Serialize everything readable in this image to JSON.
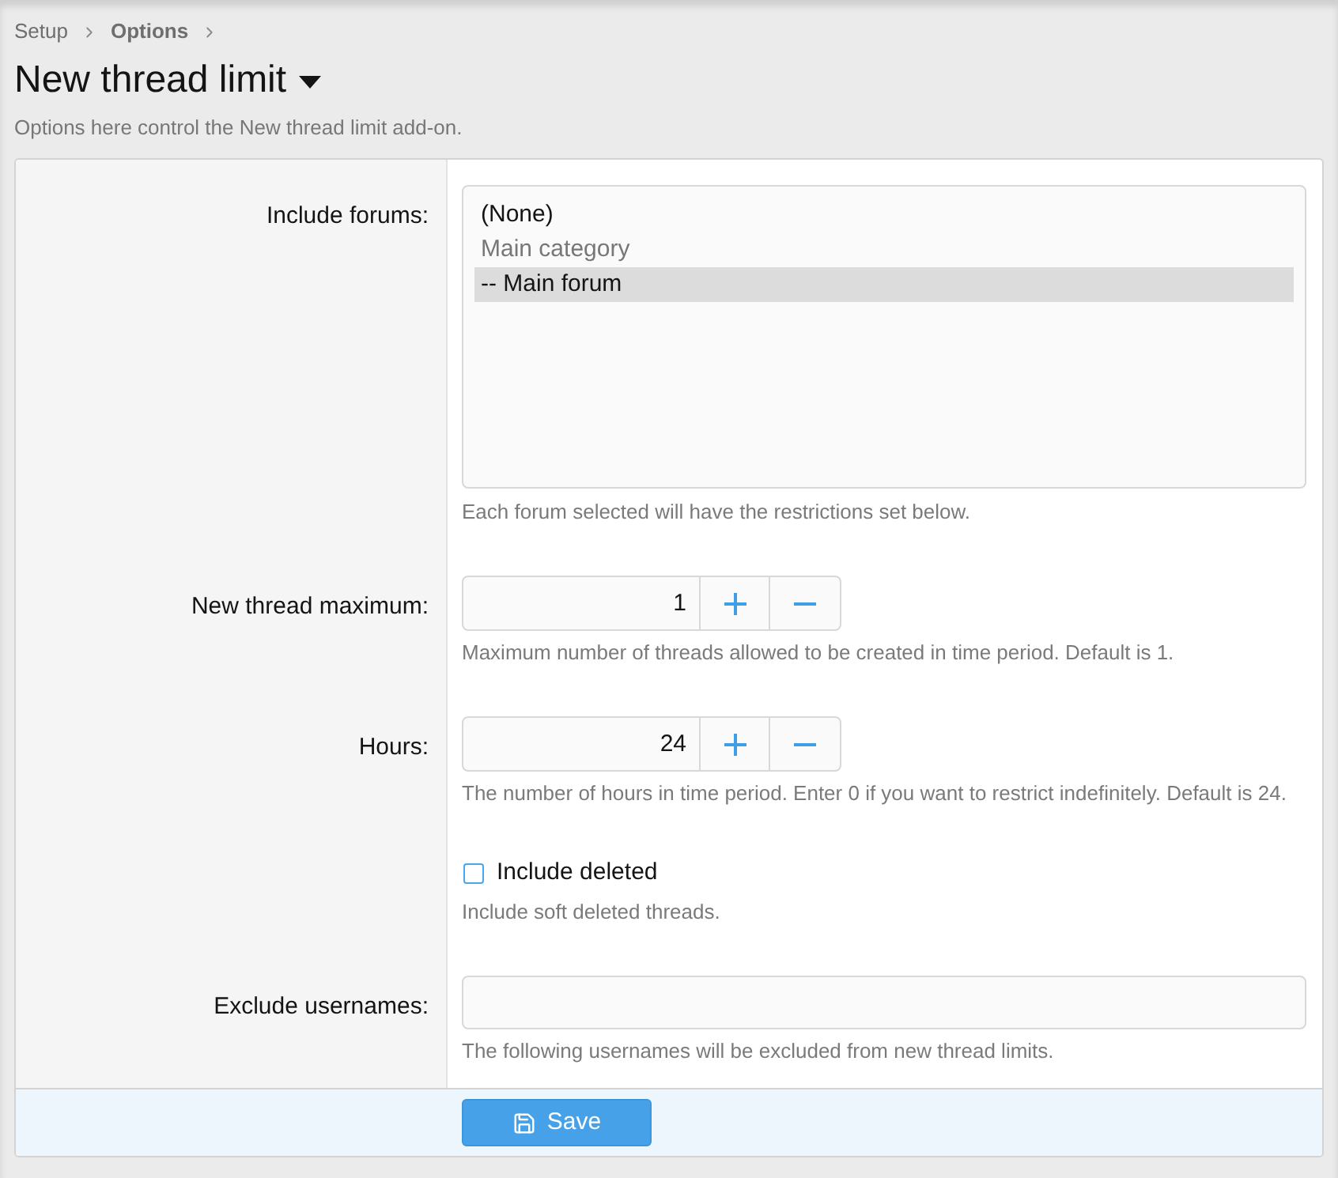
{
  "breadcrumb": [
    {
      "label": "Setup",
      "current": false
    },
    {
      "label": "Options",
      "current": true
    }
  ],
  "page": {
    "title": "New thread limit",
    "description": "Options here control the New thread limit add-on."
  },
  "form": {
    "rows": [
      {
        "kind": "listbox",
        "label": "Include forums:",
        "options": [
          {
            "label": "(None)",
            "disabled": false,
            "selected": false
          },
          {
            "label": "Main category",
            "disabled": true,
            "selected": false
          },
          {
            "label": "-- Main forum",
            "disabled": false,
            "selected": true
          }
        ],
        "hint": "Each forum selected will have the restrictions set below."
      },
      {
        "kind": "number",
        "label": "New thread maximum:",
        "value": "1",
        "hint": "Maximum number of threads allowed to be created in time period. Default is 1."
      },
      {
        "kind": "number",
        "label": "Hours:",
        "value": "24",
        "hint": "The number of hours in time period. Enter 0 if you want to restrict indefinitely. Default is 24."
      },
      {
        "kind": "checkbox",
        "text": "Include deleted",
        "checked": false,
        "hint": "Include soft deleted threads."
      },
      {
        "kind": "text",
        "label": "Exclude usernames:",
        "hint": "The following usernames will be excluded from new thread limits."
      }
    ],
    "save_button": "Save"
  }
}
